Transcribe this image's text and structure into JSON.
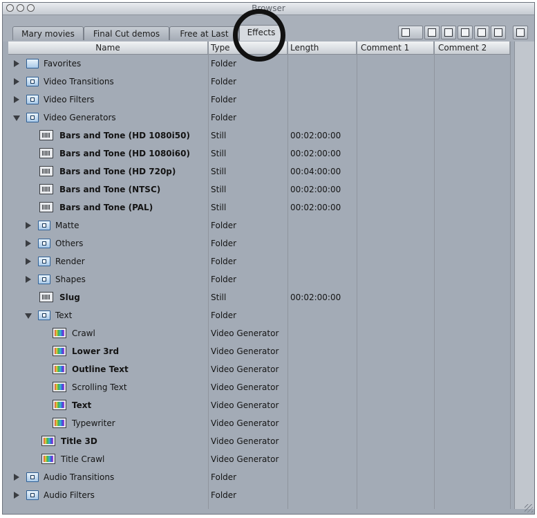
{
  "window": {
    "title": "Browser"
  },
  "tabs": [
    {
      "label": "Mary movies"
    },
    {
      "label": "Final Cut demos"
    },
    {
      "label": "Free at Last"
    },
    {
      "label": "Effects"
    }
  ],
  "columns": {
    "name": "Name",
    "type": "Type",
    "length": "Length",
    "comment1": "Comment 1",
    "comment2": "Comment 2"
  },
  "rows": [
    {
      "name": "Favorites",
      "type": "Folder",
      "length": ""
    },
    {
      "name": "Video Transitions",
      "type": "Folder",
      "length": ""
    },
    {
      "name": "Video Filters",
      "type": "Folder",
      "length": ""
    },
    {
      "name": "Video Generators",
      "type": "Folder",
      "length": ""
    },
    {
      "name": "Bars and Tone (HD 1080i50)",
      "type": "Still",
      "length": "00:02:00:00"
    },
    {
      "name": "Bars and Tone (HD 1080i60)",
      "type": "Still",
      "length": "00:02:00:00"
    },
    {
      "name": "Bars and Tone (HD 720p)",
      "type": "Still",
      "length": "00:04:00:00"
    },
    {
      "name": "Bars and Tone (NTSC)",
      "type": "Still",
      "length": "00:02:00:00"
    },
    {
      "name": "Bars and Tone (PAL)",
      "type": "Still",
      "length": "00:02:00:00"
    },
    {
      "name": "Matte",
      "type": "Folder",
      "length": ""
    },
    {
      "name": "Others",
      "type": "Folder",
      "length": ""
    },
    {
      "name": "Render",
      "type": "Folder",
      "length": ""
    },
    {
      "name": "Shapes",
      "type": "Folder",
      "length": ""
    },
    {
      "name": "Slug",
      "type": "Still",
      "length": "00:02:00:00"
    },
    {
      "name": "Text",
      "type": "Folder",
      "length": ""
    },
    {
      "name": "Crawl",
      "type": "Video Generator",
      "length": ""
    },
    {
      "name": "Lower 3rd",
      "type": "Video Generator",
      "length": ""
    },
    {
      "name": "Outline Text",
      "type": "Video Generator",
      "length": ""
    },
    {
      "name": "Scrolling Text",
      "type": "Video Generator",
      "length": ""
    },
    {
      "name": "Text",
      "type": "Video Generator",
      "length": ""
    },
    {
      "name": "Typewriter",
      "type": "Video Generator",
      "length": ""
    },
    {
      "name": "Title 3D",
      "type": "Video Generator",
      "length": ""
    },
    {
      "name": "Title Crawl",
      "type": "Video Generator",
      "length": ""
    },
    {
      "name": "Audio Transitions",
      "type": "Folder",
      "length": ""
    },
    {
      "name": "Audio Filters",
      "type": "Folder",
      "length": ""
    }
  ]
}
